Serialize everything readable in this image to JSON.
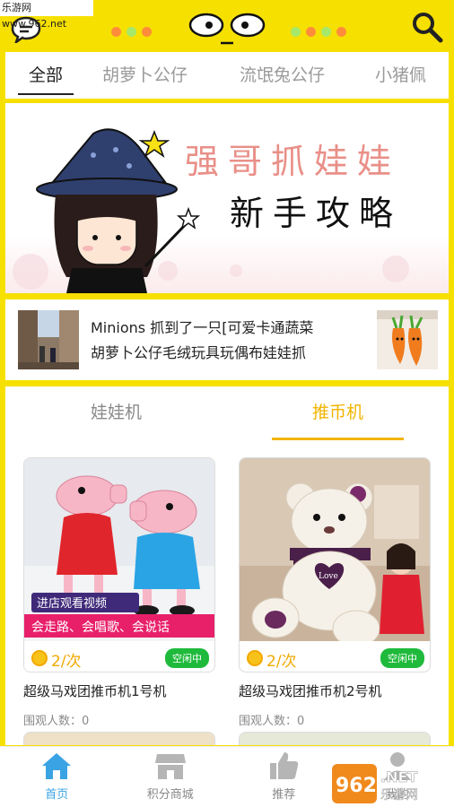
{
  "watermark_top": "乐游网 www.962.net",
  "colors": {
    "brand_yellow": "#f6e000",
    "accent_orange": "#f2b400",
    "status_green": "#1fba3c",
    "nav_active_blue": "#3aa3e3"
  },
  "category_tabs": [
    "全部",
    "胡萝卜公仔",
    "流氓兔公仔",
    "小猪佩"
  ],
  "banner": {
    "title": "强哥抓娃娃",
    "subtitle": "新手攻略"
  },
  "news": {
    "line1": "Minions  抓到了一只[可爱卡通蔬菜",
    "line2": "胡萝卜公仔毛绒玩具玩偶布娃娃抓"
  },
  "section_tabs": [
    "娃娃机",
    "推币机"
  ],
  "machines": [
    {
      "price": "2/次",
      "status": "空闲中",
      "name": "超级马戏团推币机1号机",
      "watchers": "围观人数：0",
      "promo1": "进店观看视频",
      "promo2": "会走路、会唱歌、会说话"
    },
    {
      "price": "2/次",
      "status": "空闲中",
      "name": "超级马戏团推币机2号机",
      "watchers": "围观人数：0",
      "badge": "Love"
    }
  ],
  "bottom_nav": [
    "首页",
    "积分商城",
    "推荐",
    "我的"
  ],
  "watermark_bottom": {
    "logo": "962",
    "suffix": ".NET",
    "text": "乐游网"
  }
}
